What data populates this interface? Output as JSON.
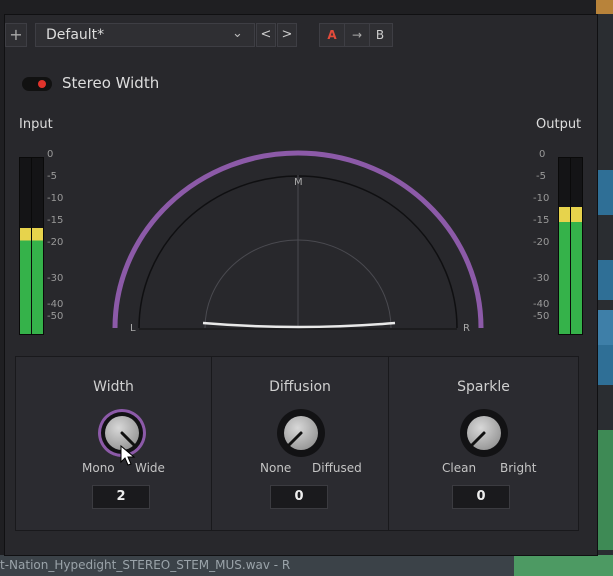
{
  "toolbar": {
    "add_label": "+",
    "preset_name": "Default*",
    "prev_label": "<",
    "next_label": ">",
    "ab_a": "A",
    "ab_arrow": "→",
    "ab_b": "B"
  },
  "plugin": {
    "title": "Stereo Width",
    "enabled": true,
    "input_label": "Input",
    "output_label": "Output",
    "scale_ticks": [
      "0",
      "-5",
      "-10",
      "-15",
      "-20",
      "-30",
      "-40",
      "-50"
    ]
  },
  "meter_levels": {
    "input": {
      "left": 0.6,
      "right": 0.6
    },
    "output": {
      "left": 0.72,
      "right": 0.72
    }
  },
  "scope": {
    "top_label": "M",
    "left_label": "L",
    "right_label": "R"
  },
  "controls": [
    {
      "name": "Width",
      "min_label": "Mono",
      "max_label": "Wide",
      "value": "2"
    },
    {
      "name": "Diffusion",
      "min_label": "None",
      "max_label": "Diffused",
      "value": "0"
    },
    {
      "name": "Sparkle",
      "min_label": "Clean",
      "max_label": "Bright",
      "value": "0"
    }
  ],
  "background_clip": {
    "label": "t-Nation_Hypedight_STEREO_STEM_MUS.wav - R"
  },
  "colors": {
    "accent_purple": "#8c5aa8",
    "meter_green": "#35b24a",
    "meter_yellow": "#e7d34c",
    "power_red": "#e0332b"
  }
}
